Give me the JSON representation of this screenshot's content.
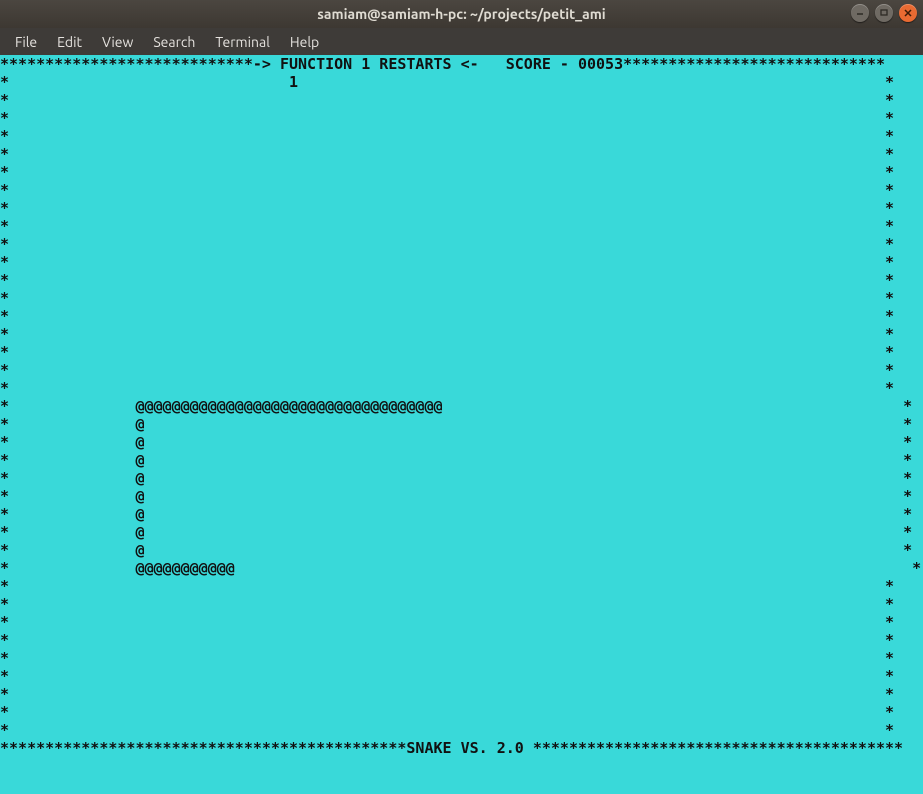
{
  "window": {
    "title": "samiam@samiam-h-pc: ~/projects/petit_ami"
  },
  "menu": {
    "file": "File",
    "edit": "Edit",
    "view": "View",
    "search": "Search",
    "terminal": "Terminal",
    "help": "Help"
  },
  "colors": {
    "terminal_bg": "#39d9d9",
    "terminal_fg": "#111111",
    "titlebar_bg": "#3d3832",
    "menubar_bg": "#3e3b38",
    "close_btn": "#e86a32"
  },
  "game": {
    "header_prefix_stars": "****************************",
    "header_center": "-> FUNCTION 1 RESTARTS <-   SCORE - 00053",
    "header_suffix_stars": "*****************************",
    "header_number_line_indent": "                               ",
    "header_number": "1",
    "function": "1",
    "restarts": "1",
    "score": "00053",
    "side_star": "*",
    "side_star_right_pad": "                                                                                                 ",
    "snake_indent": "              ",
    "snake_rows": [
      "@@@@@@@@@@@@@@@@@@@@@@@@@@@@@@@@@@",
      "@",
      "@",
      "@",
      "@",
      "@",
      "@",
      "@",
      "@",
      "@@@@@@@@@@@"
    ],
    "snake_tail_pad": [
      "                                                   ",
      "                                                                                    ",
      "                                                                                    ",
      "                                                                                    ",
      "                                                                                    ",
      "                                                                                    ",
      "                                                                                    ",
      "                                                                                    ",
      "                                                                                    ",
      "                                                                           "
    ],
    "footer_prefix_stars": "*********************************************",
    "footer_title": "SNAKE VS. 2.0",
    "footer_suffix_stars": " *****************************************"
  }
}
